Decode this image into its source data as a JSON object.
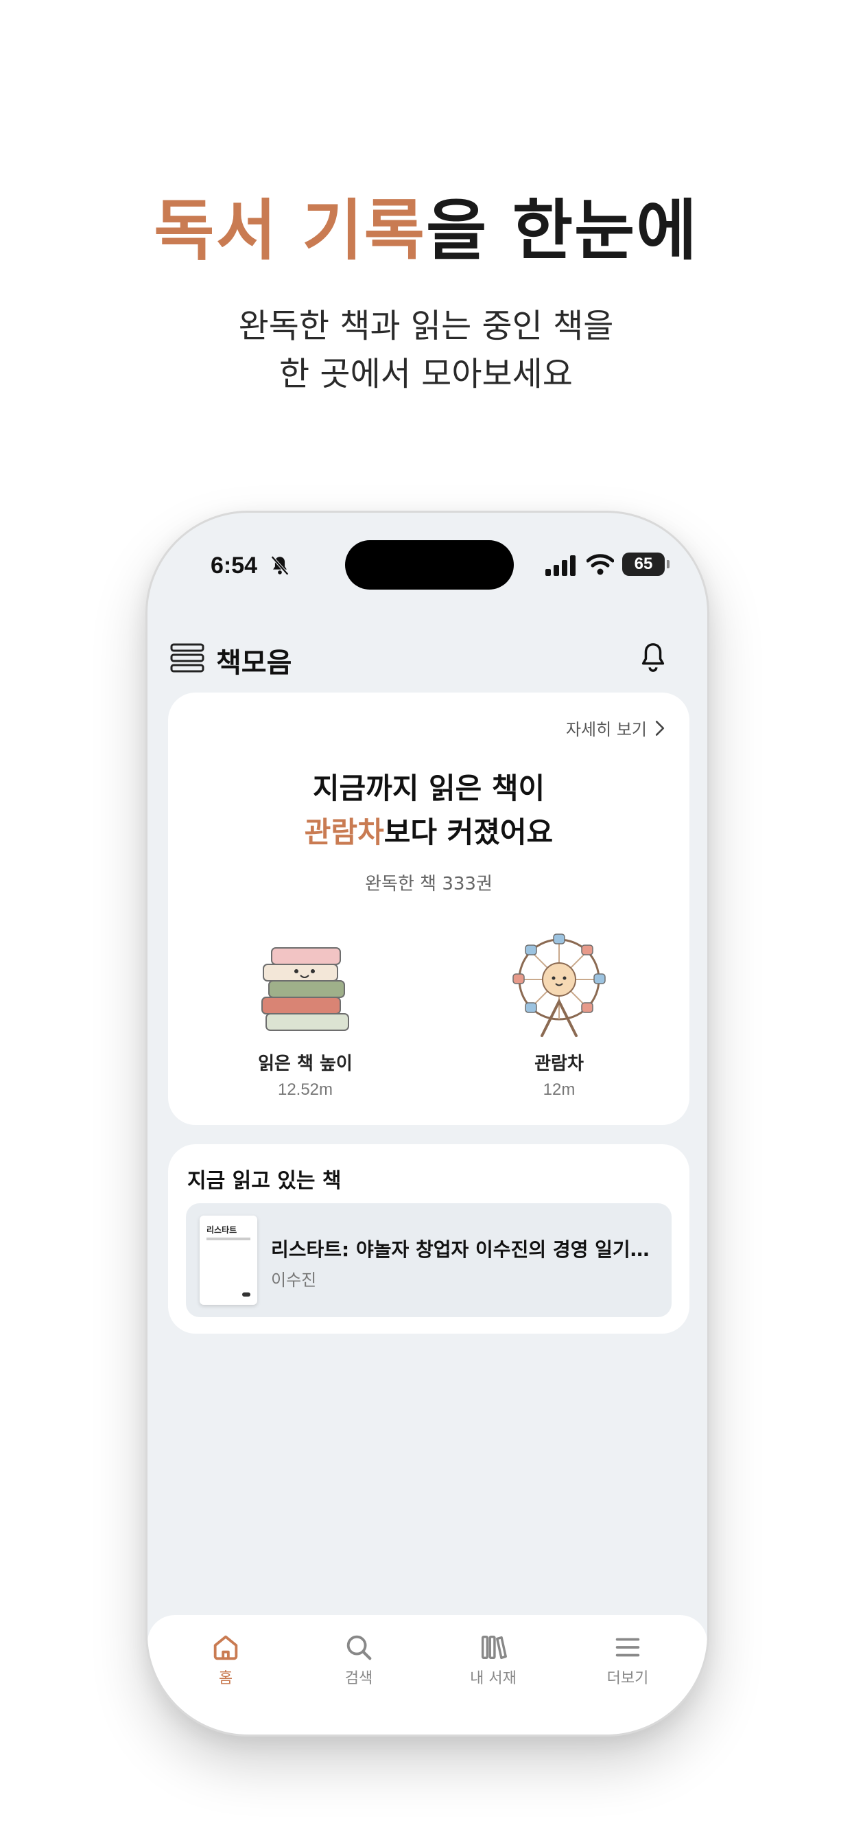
{
  "promo": {
    "headline_accent": "독서 기록",
    "headline_rest": "을 한눈에",
    "sub_line1": "완독한 책과 읽는 중인 책을",
    "sub_line2": "한 곳에서 모아보세요"
  },
  "status_bar": {
    "time": "6:54",
    "battery": "65"
  },
  "app": {
    "title": "책모음"
  },
  "summary_card": {
    "detail_link": "자세히 보기",
    "title_line1": "지금까지 읽은 책이",
    "title_line2_accent": "관람차",
    "title_line2_rest": "보다 커졌어요",
    "subtitle": "완독한 책 333권",
    "left": {
      "label": "읽은 책 높이",
      "value": "12.52m"
    },
    "right": {
      "label": "관람차",
      "value": "12m"
    }
  },
  "reading_card": {
    "title": "지금 읽고 있는 책",
    "book": {
      "cover_text": "리스타트",
      "title": "리스타트: 야놀자 창업자 이수진의 경영 일기 (야…",
      "author": "이수진"
    }
  },
  "tabbar": {
    "home": "홈",
    "search": "검색",
    "library": "내 서재",
    "more": "더보기"
  },
  "colors": {
    "accent": "#C97B52",
    "background": "#EEF1F4",
    "card": "#FFFFFF"
  }
}
